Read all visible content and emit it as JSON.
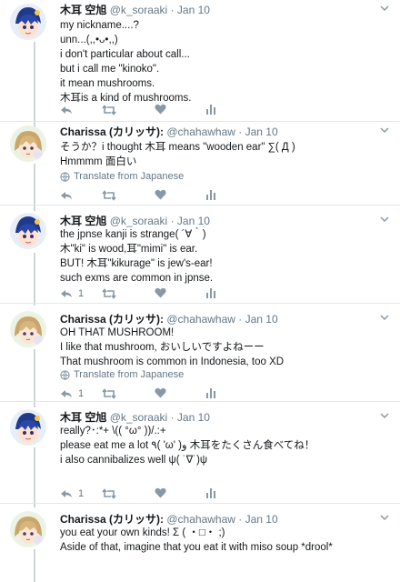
{
  "tweets": [
    {
      "author": "木耳 空旭",
      "handle": "@k_soraaki",
      "date": "· Jan 10",
      "lines": [
        "my nickname....?",
        "unn...(,,•ᴗ•,,)",
        "i don't particular about call...",
        "but i call me \"kinoko\".",
        "it mean mushrooms.",
        "木耳is a kind of mushrooms."
      ],
      "translate": "",
      "reply_count": "",
      "retweet_count": "",
      "like_count": ""
    },
    {
      "author": "Charissa (カリッサ):",
      "handle": "@chahawhaw",
      "date": "· Jan 10",
      "lines": [
        "そうか？i thought 木耳 means \"wooden ear\" ∑( Д )",
        "Hmmmm 面白い"
      ],
      "translate": "Translate from Japanese",
      "reply_count": "",
      "retweet_count": "",
      "like_count": ""
    },
    {
      "author": "木耳 空旭",
      "handle": "@k_soraaki",
      "date": "· Jan 10",
      "lines": [
        "the jpnse kanji is strange( ´∀｀)",
        "木\"ki\" is wood,耳\"mimi\" is ear.",
        "BUT! 木耳\"kikurage\" is jew's-ear!",
        "such exms are common in jpnse."
      ],
      "translate": "",
      "reply_count": "1",
      "retweet_count": "",
      "like_count": ""
    },
    {
      "author": "Charissa (カリッサ):",
      "handle": "@chahawhaw",
      "date": "· Jan 10",
      "lines": [
        "OH THAT MUSHROOM!",
        "I like that mushroom, おいしいですよねーー",
        "That mushroom is common in Indonesia, too XD"
      ],
      "translate": "Translate from Japanese",
      "reply_count": "1",
      "retweet_count": "",
      "like_count": ""
    },
    {
      "author": "木耳 空旭",
      "handle": "@k_soraaki",
      "date": "· Jan 10",
      "lines": [
        "really?･:*+ \\(( °ω° ))/.:+",
        "please eat me a lot ٩( 'ω' )و 木耳をたくさん食べてね！",
        "i also cannibalizes well ψ( ˙∇˙)ψ"
      ],
      "translate": "",
      "reply_count": "1",
      "retweet_count": "",
      "like_count": ""
    },
    {
      "author": "Charissa (カリッサ):",
      "handle": "@chahawhaw",
      "date": "· Jan 10",
      "lines": [
        "you eat your own kinds! Σ ( ・□・ ;)",
        "Aside of that, imagine that you eat it with miso soup *drool*"
      ],
      "translate": "",
      "reply_count": "",
      "retweet_count": "",
      "like_count": ""
    }
  ],
  "colors": {
    "text": "#14171a",
    "secondary": "#657786",
    "divider": "#e1e8ed",
    "thread": "#ccd6dd"
  }
}
